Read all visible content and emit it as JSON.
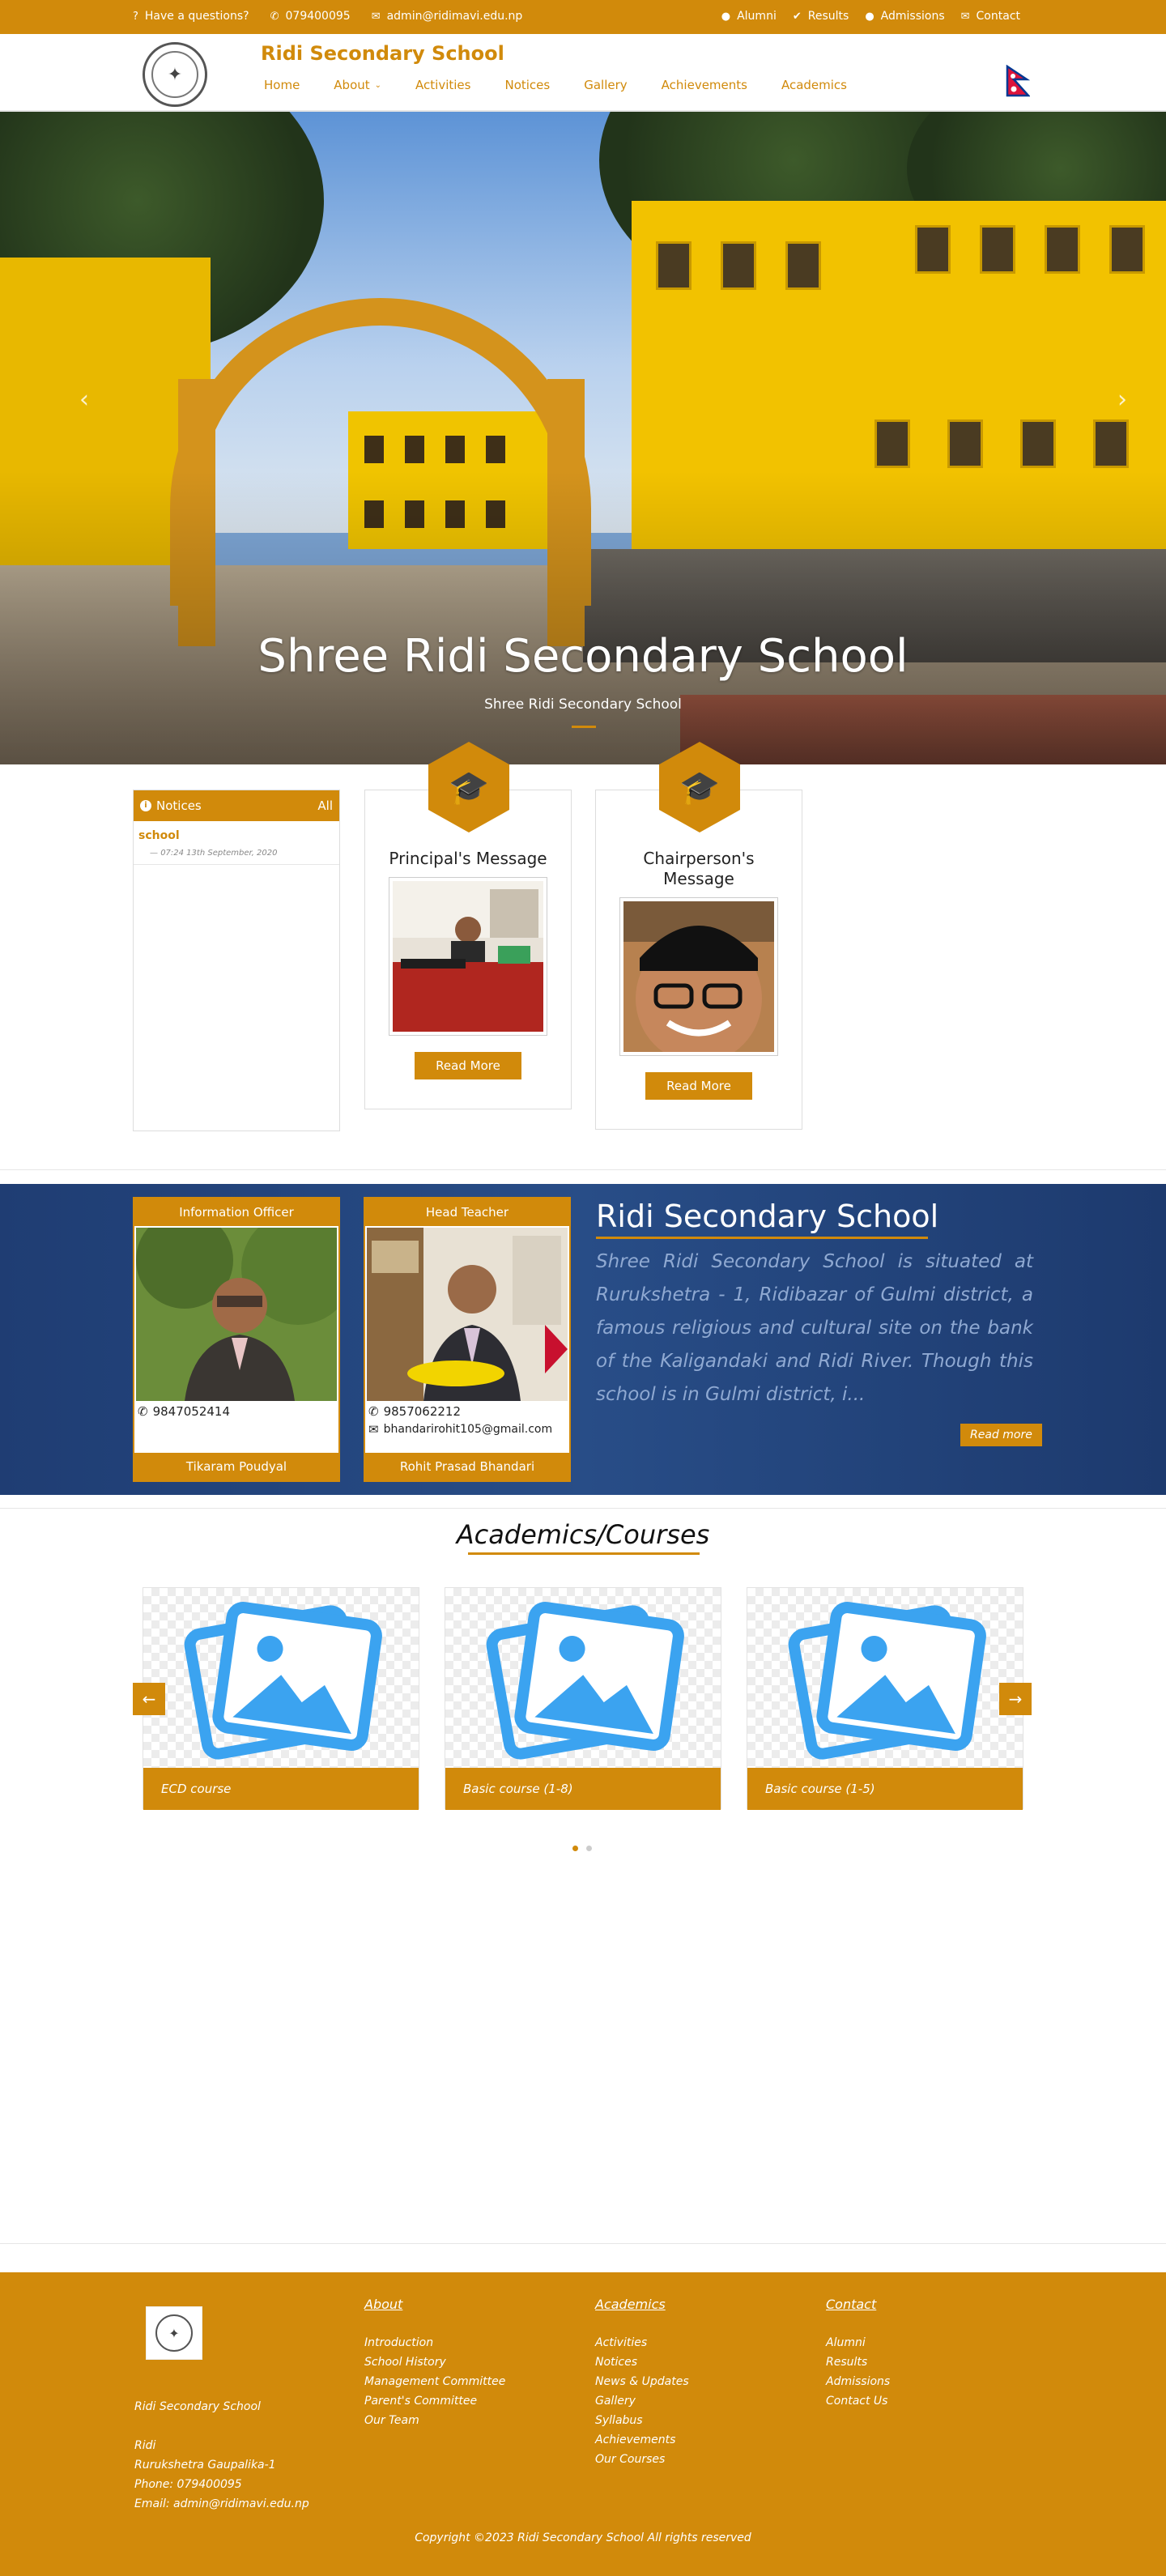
{
  "topbar": {
    "question": "Have a questions?",
    "phone": "079400095",
    "email": "admin@ridimavi.edu.np",
    "links": [
      "Alumni",
      "Results",
      "Admissions",
      "Contact"
    ]
  },
  "header": {
    "brand": "Ridi Secondary School",
    "nav": [
      "Home",
      "About",
      "Activities",
      "Notices",
      "Gallery",
      "Achievements",
      "Academics"
    ]
  },
  "hero": {
    "title": "Shree Ridi Secondary School",
    "subtitle": "Shree Ridi Secondary School"
  },
  "notices": {
    "heading": "Notices",
    "all": "All",
    "items": [
      {
        "title": "school",
        "date": "07:24 13th September, 2020"
      }
    ]
  },
  "messages": [
    {
      "title": "Principal's Message",
      "button": "Read More"
    },
    {
      "title": "Chairperson's Message",
      "button": "Read More"
    }
  ],
  "staff": [
    {
      "role": "Information Officer",
      "phone": "9847052414",
      "email": "",
      "name": "Tikaram Poudyal"
    },
    {
      "role": "Head Teacher",
      "phone": "9857062212",
      "email": "bhandarirohit105@gmail.com",
      "name": "Rohit Prasad Bhandari"
    }
  ],
  "about": {
    "title": "Ridi Secondary School",
    "text": "Shree Ridi Secondary School is situated at Rurukshetra - 1, Ridibazar of Gulmi district, a famous religious and cultural site on the bank of the Kaligandaki and Ridi River. Though this school is in Gulmi district, i...",
    "button": "Read more"
  },
  "academics": {
    "title": "Academics/Courses",
    "courses": [
      "ECD course",
      "Basic course (1-8)",
      "Basic course (1-5)"
    ]
  },
  "footer": {
    "school": "Ridi Secondary School",
    "address_lines": [
      "Ridi",
      "Rurukshetra Gaupalika-1",
      "Phone: 079400095",
      "Email: admin@ridimavi.edu.np"
    ],
    "about": {
      "heading": "About",
      "links": [
        "Introduction",
        "School History",
        "Management Committee",
        "Parent's Committee",
        "Our Team"
      ]
    },
    "academics": {
      "heading": "Academics",
      "links": [
        "Activities",
        "Notices",
        "News & Updates",
        "Gallery",
        "Syllabus",
        "Achievements",
        "Our Courses"
      ]
    },
    "contact": {
      "heading": "Contact",
      "links": [
        "Alumni",
        "Results",
        "Admissions",
        "Contact Us"
      ]
    },
    "copyright": "Copyright ©2023 Ridi Secondary School All rights reserved"
  },
  "colors": {
    "accent": "#d18a0b",
    "band": "#284d87"
  }
}
